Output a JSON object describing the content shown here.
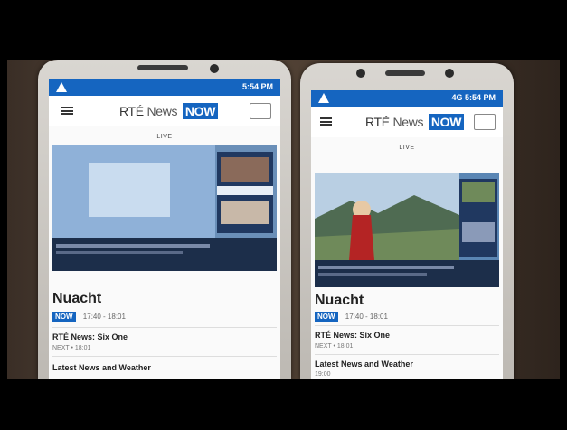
{
  "phones": [
    {
      "status_right": "5:54 PM",
      "logo_rte": "RTÉ",
      "logo_news": "News",
      "logo_now": "NOW",
      "live_label": "LIVE",
      "section_title": "Nuacht",
      "now_badge": "NOW",
      "time_range": "17:40 - 18:01",
      "programmes": [
        {
          "title": "RTÉ News: Six One",
          "subtitle": "NEXT • 18:01"
        },
        {
          "title": "Latest News and Weather",
          "subtitle": ""
        }
      ]
    },
    {
      "status_right": "4G 5:54 PM",
      "logo_rte": "RTÉ",
      "logo_news": "News",
      "logo_now": "NOW",
      "live_label": "LIVE",
      "section_title": "Nuacht",
      "now_badge": "NOW",
      "time_range": "17:40 - 18:01",
      "programmes": [
        {
          "title": "RTÉ News: Six One",
          "subtitle": "NEXT • 18:01"
        },
        {
          "title": "Latest News and Weather",
          "subtitle": "19:00"
        }
      ]
    }
  ],
  "colors": {
    "brand_blue": "#1565c0",
    "background": "#000000"
  }
}
